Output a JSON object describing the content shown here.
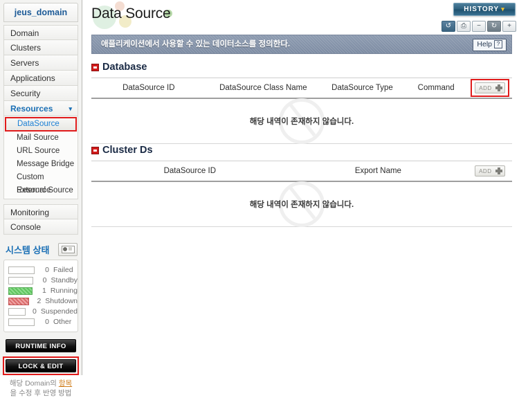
{
  "sidebar": {
    "domain_title": "jeus_domain",
    "nav": [
      {
        "label": "Domain",
        "expanded": false
      },
      {
        "label": "Clusters",
        "expanded": false
      },
      {
        "label": "Servers",
        "expanded": false
      },
      {
        "label": "Applications",
        "expanded": false
      },
      {
        "label": "Security",
        "expanded": false
      },
      {
        "label": "Resources",
        "expanded": true,
        "chevron": "chevron-down-icon"
      }
    ],
    "sub_items": [
      {
        "label": "DataSource",
        "active": true
      },
      {
        "label": "Mail Source",
        "active": false
      },
      {
        "label": "URL Source",
        "active": false
      },
      {
        "label": "Message Bridge",
        "active": false
      },
      {
        "label": "Custom Resource",
        "active": false
      },
      {
        "label": "External Source",
        "active": false
      }
    ],
    "nav_bottom": [
      {
        "label": "Monitoring"
      },
      {
        "label": "Console"
      }
    ],
    "system_status": {
      "title": "시스템 상태",
      "icon": "monitor-icon",
      "rows": [
        {
          "count": "0",
          "label": "Failed",
          "state": "none"
        },
        {
          "count": "0",
          "label": "Standby",
          "state": "none"
        },
        {
          "count": "1",
          "label": "Running",
          "state": "running"
        },
        {
          "count": "2",
          "label": "Shutdown",
          "state": "shutdown"
        },
        {
          "count": "0",
          "label": "Suspended",
          "state": "none"
        },
        {
          "count": "0",
          "label": "Other",
          "state": "none"
        }
      ]
    },
    "runtime_info_label": "RUNTIME INFO",
    "lock_edit_label": "LOCK & EDIT",
    "footer_note_1": "해당 Domain의 ",
    "footer_note_link": "항목",
    "footer_note_2": "을 수정 후 반영 방법"
  },
  "header": {
    "page_title": "Data Source",
    "history_label": "HISTORY",
    "history_chevron": "chevron-down-icon",
    "toolbar": [
      {
        "name": "refresh-view-icon",
        "glyph": "↺",
        "style": "dark"
      },
      {
        "name": "print-icon",
        "glyph": "⎙",
        "style": "light"
      },
      {
        "name": "zoom-out-icon",
        "glyph": "−",
        "style": "light"
      },
      {
        "name": "zoom-reset-icon",
        "glyph": "↻",
        "style": "slate"
      },
      {
        "name": "zoom-in-icon",
        "glyph": "+",
        "style": "light"
      }
    ],
    "description": "애플리케이션에서 사용할 수 있는 데이터소스를 정의한다.",
    "help_label": "Help",
    "help_glyph": "?"
  },
  "sections": [
    {
      "title": "Database",
      "columns": [
        "DataSource ID",
        "DataSource Class Name",
        "DataSource Type",
        "Command"
      ],
      "add_label": "ADD",
      "add_highlighted": true,
      "empty_message": "해당 내역이 존재하지 않습니다.",
      "rows": []
    },
    {
      "title": "Cluster Ds",
      "columns": [
        "DataSource ID",
        "Export Name"
      ],
      "add_label": "ADD",
      "add_highlighted": false,
      "empty_message": "해당 내역이 존재하지 않습니다.",
      "rows": []
    }
  ],
  "colors": {
    "accent_blue": "#1a6fb5",
    "highlight_red": "#e01b1b",
    "desc_bar": "#7d8ca3",
    "history_btn": "#2d5f7d",
    "running_green": "#5fc45f",
    "shutdown_red": "#d96a6a"
  }
}
